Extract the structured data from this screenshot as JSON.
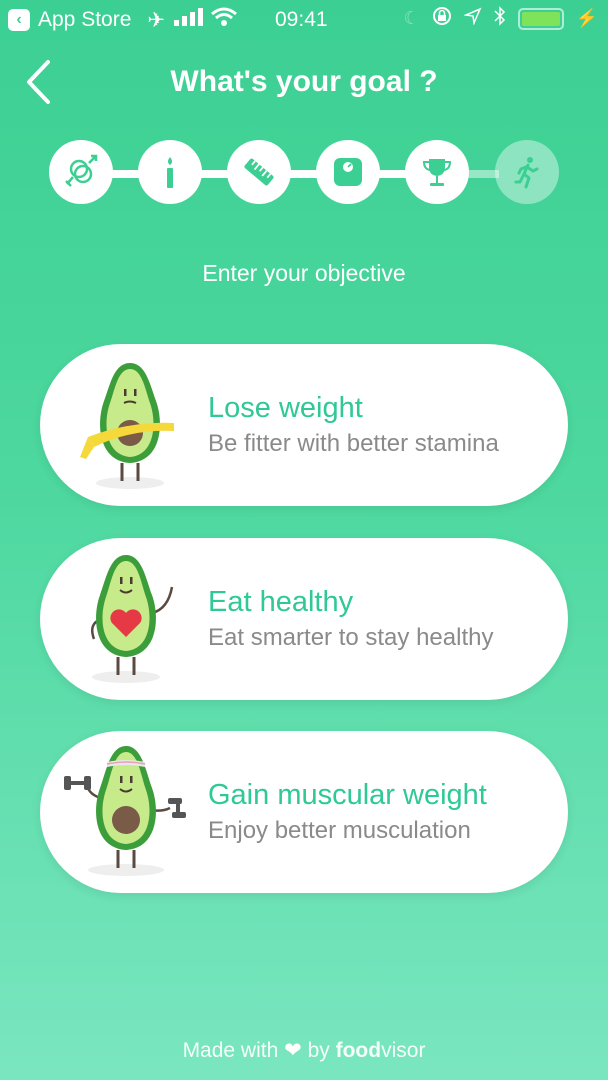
{
  "status_bar": {
    "back_app": "App Store",
    "time": "09:41",
    "icons": [
      "back-app-icon",
      "airplane-icon",
      "signal-icon",
      "wifi-icon",
      "moon-icon",
      "orientation-lock-icon",
      "location-icon",
      "bluetooth-icon",
      "battery-icon",
      "charging-icon"
    ],
    "battery_level": 1.0
  },
  "header": {
    "title": "What's your goal ?",
    "back_icon": "chevron-left-icon"
  },
  "stepper": {
    "steps": [
      {
        "icon": "gender-icon",
        "state": "done"
      },
      {
        "icon": "candle-icon",
        "state": "done"
      },
      {
        "icon": "ruler-icon",
        "state": "done"
      },
      {
        "icon": "scale-icon",
        "state": "done"
      },
      {
        "icon": "trophy-icon",
        "state": "done"
      },
      {
        "icon": "running-icon",
        "state": "current"
      }
    ],
    "current_step": 6,
    "total_steps": 6
  },
  "subtitle": "Enter your objective",
  "goals": [
    {
      "title": "Lose weight",
      "description": "Be fitter with better stamina",
      "illustration": "avocado-measuring-tape-icon"
    },
    {
      "title": "Eat healthy",
      "description": "Eat smarter to stay healthy",
      "illustration": "avocado-heart-icon"
    },
    {
      "title": "Gain muscular weight",
      "description": "Enjoy better musculation",
      "illustration": "avocado-dumbbells-icon"
    }
  ],
  "footer": {
    "made_with": "Made with",
    "by": "by",
    "brand_bold": "food",
    "brand_light": "visor"
  },
  "colors": {
    "accent": "#2ec994",
    "background_top": "#3ccf93",
    "background_bottom": "#7ae6c0",
    "description_text": "#8a8a8a"
  }
}
